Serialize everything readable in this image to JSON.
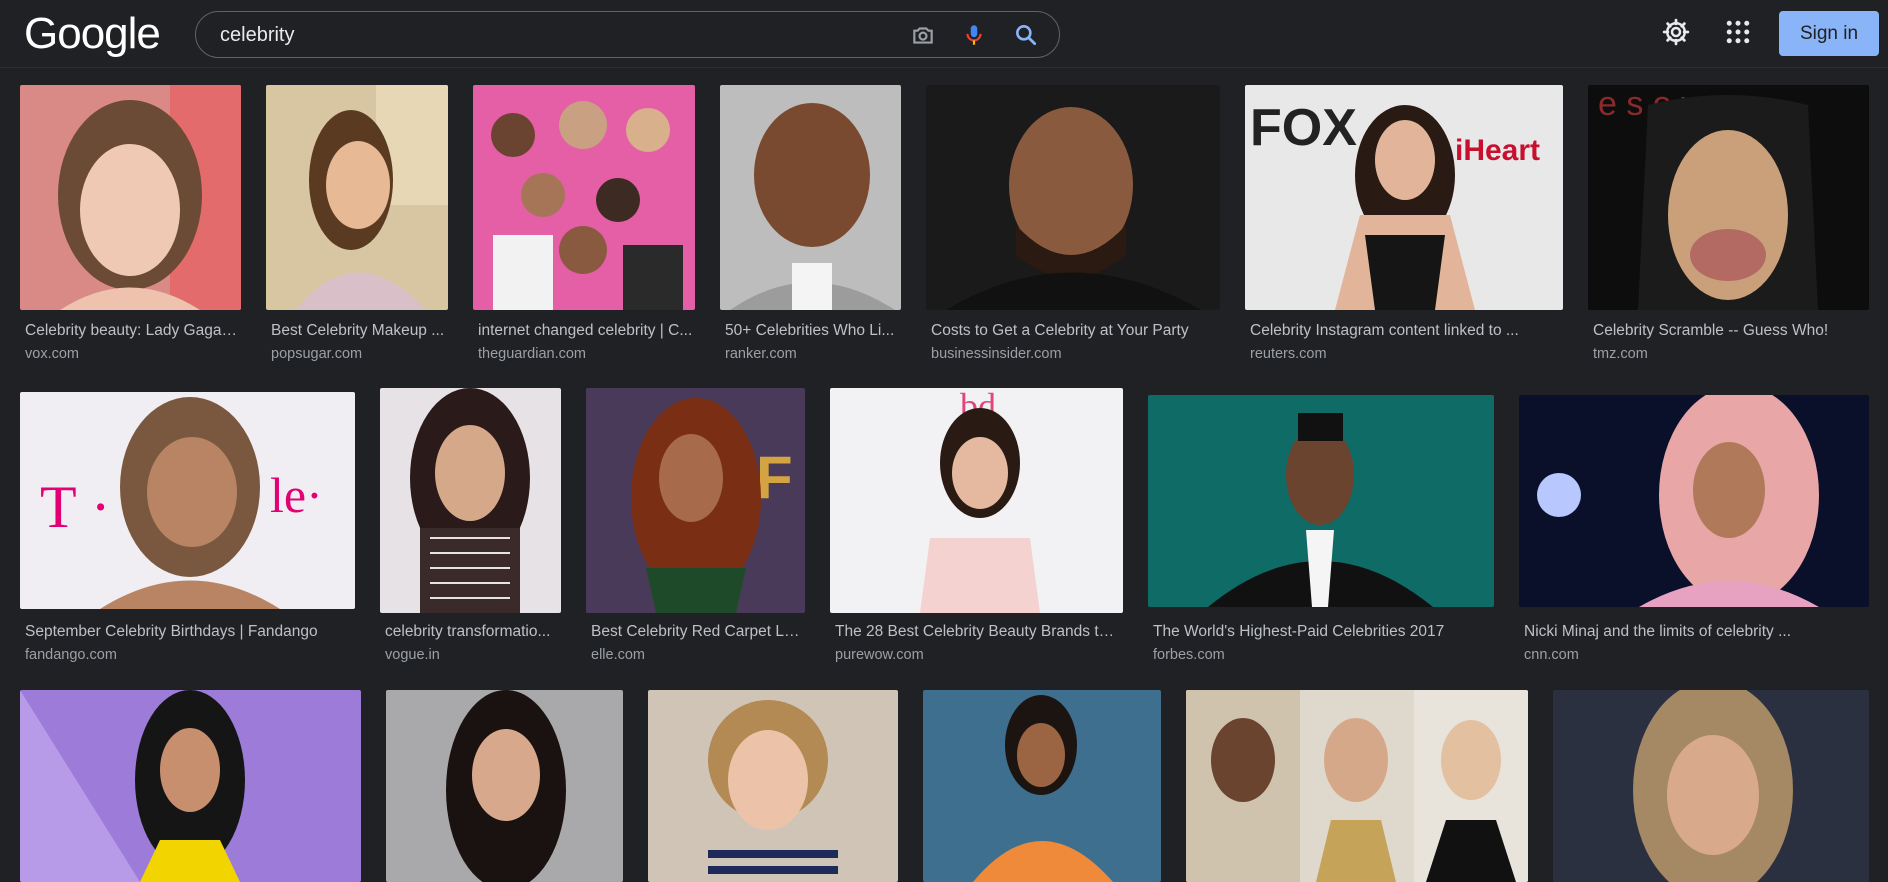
{
  "logo": "Google",
  "search": {
    "query": "celebrity"
  },
  "header": {
    "sign_in": "Sign in"
  },
  "icons": {
    "camera": "camera-icon",
    "mic": "mic-icon",
    "search": "search-icon",
    "settings": "gear-icon",
    "apps": "apps-grid-icon"
  },
  "colors": {
    "background": "#202124",
    "accent": "#8ab4f8",
    "caption": "#bdc1c6",
    "source": "#9aa0a6"
  },
  "results": {
    "row1": [
      {
        "caption": "Celebrity beauty: Lady Gaga, ...",
        "source": "vox.com"
      },
      {
        "caption": "Best Celebrity Makeup ...",
        "source": "popsugar.com"
      },
      {
        "caption": "internet changed celebrity | C...",
        "source": "theguardian.com"
      },
      {
        "caption": "50+ Celebrities Who Li...",
        "source": "ranker.com"
      },
      {
        "caption": "Costs to Get a Celebrity at Your Party",
        "source": "businessinsider.com"
      },
      {
        "caption": "Celebrity Instagram content linked to ...",
        "source": "reuters.com"
      },
      {
        "caption": "Celebrity Scramble -- Guess Who!",
        "source": "tmz.com"
      }
    ],
    "row2": [
      {
        "caption": "September Celebrity Birthdays | Fandango",
        "source": "fandango.com"
      },
      {
        "caption": "celebrity transformatio...",
        "source": "vogue.in"
      },
      {
        "caption": "Best Celebrity Red Carpet Lo...",
        "source": "elle.com"
      },
      {
        "caption": "The 28 Best Celebrity Beauty Brands to ...",
        "source": "purewow.com"
      },
      {
        "caption": "The World's Highest-Paid Celebrities 2017",
        "source": "forbes.com"
      },
      {
        "caption": "Nicki Minaj and the limits of celebrity ...",
        "source": "cnn.com"
      }
    ],
    "row3": [
      {
        "caption": "",
        "source": ""
      },
      {
        "caption": "",
        "source": ""
      },
      {
        "caption": "",
        "source": ""
      },
      {
        "caption": "",
        "source": ""
      },
      {
        "caption": "",
        "source": ""
      },
      {
        "caption": "",
        "source": ""
      }
    ]
  }
}
